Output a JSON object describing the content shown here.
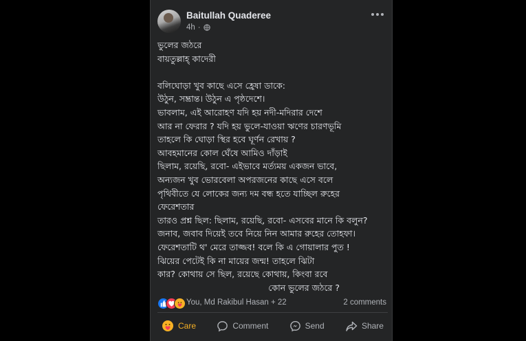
{
  "post": {
    "author": "Baitullah Quaderee",
    "time": "4h",
    "separator": "·",
    "more_icon": "more-horizontal-icon",
    "privacy_icon": "globe-icon",
    "lines": [
      "ভুলের জঠরে",
      "বায়তুল্লাহ্ কাদেরী",
      "",
      "বলিঘোড়া খুব কাছে এসে হ্রেষা ডাকে:",
      "উঠুন, সম্ভ্রান্ত। উঠুন এ পৃষ্ঠদেশে।",
      "ভাবলাম, এই আরোহণ যদি হয় নদী-মদিরার দেশে",
      "আর না ফেরার ? যদি হয় ভুলে-যাওয়া ঋণের চারণভূমি",
      "তাহলে কি ঘোড়া স্থির হবে ঘূর্ণন রেখায় ?",
      "আবহমানের কোল ঘেঁষে আমিও দাঁড়াই",
      "ছিলাম, রয়েছি, রবো- এইভাবে মর্ত্যময় একজন ভাবে,",
      "অন্যজন খুব ভোরবেলা অপরজনের কাছে এসে বলে",
      "পৃথিবীতে যে লোকের জন্য দম বন্ধ হতে যাচ্ছিল রুহের",
      "ফেরেশতার",
      "তারও প্রশ্ন ছিল: ছিলাম, রয়েছি, রবো- এসবের মানে কি বলুন?",
      "জনাব, জবাব দিয়েই তবে নিয়ে নিন আমার রুহের তোহফা।",
      "ফেরেশতাটি থ' মেরে তাজ্জব! বলে কি এ গোয়ালার পুত !",
      "ঝিয়ের পেটেই কি না মায়ের জন্ম! তাহলে ঝিটা",
      "কার? কোথায় সে ছিল, রয়েছে কোথায়, কিংবা রবে",
      "কোন ভুলের জঠরে ?"
    ]
  },
  "reactions": {
    "names": "You, Md Rakibul Hasan + 22",
    "comments": "2 comments"
  },
  "actions": {
    "care": "Care",
    "comment": "Comment",
    "send": "Send",
    "share": "Share"
  },
  "colors": {
    "card_bg": "#242526",
    "text": "#e4e6eb",
    "muted": "#b0b3b8",
    "care": "#f7b125",
    "like": "#1877f2",
    "love": "#f33e58"
  }
}
